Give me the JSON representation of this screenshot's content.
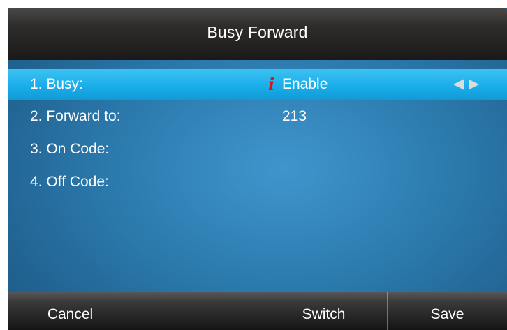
{
  "header": {
    "title": "Busy Forward"
  },
  "menu": {
    "items": [
      {
        "label": "1. Busy:",
        "value": "Enable",
        "selected": true
      },
      {
        "label": "2. Forward to:",
        "value": "213"
      },
      {
        "label": "3. On Code:",
        "value": ""
      },
      {
        "label": "4. Off Code:",
        "value": ""
      }
    ]
  },
  "icons": {
    "info": "info-icon",
    "left_arrow": "left-arrow-icon",
    "right_arrow": "right-arrow-icon"
  },
  "softkeys": [
    {
      "label": "Cancel"
    },
    {
      "label": ""
    },
    {
      "label": "Switch"
    },
    {
      "label": "Save"
    }
  ],
  "colors": {
    "info_icon": "#e1101a",
    "selected_row": "#1aaeea",
    "screen_background": "#2d7cb0",
    "title_bar": "#2e2d2c"
  }
}
